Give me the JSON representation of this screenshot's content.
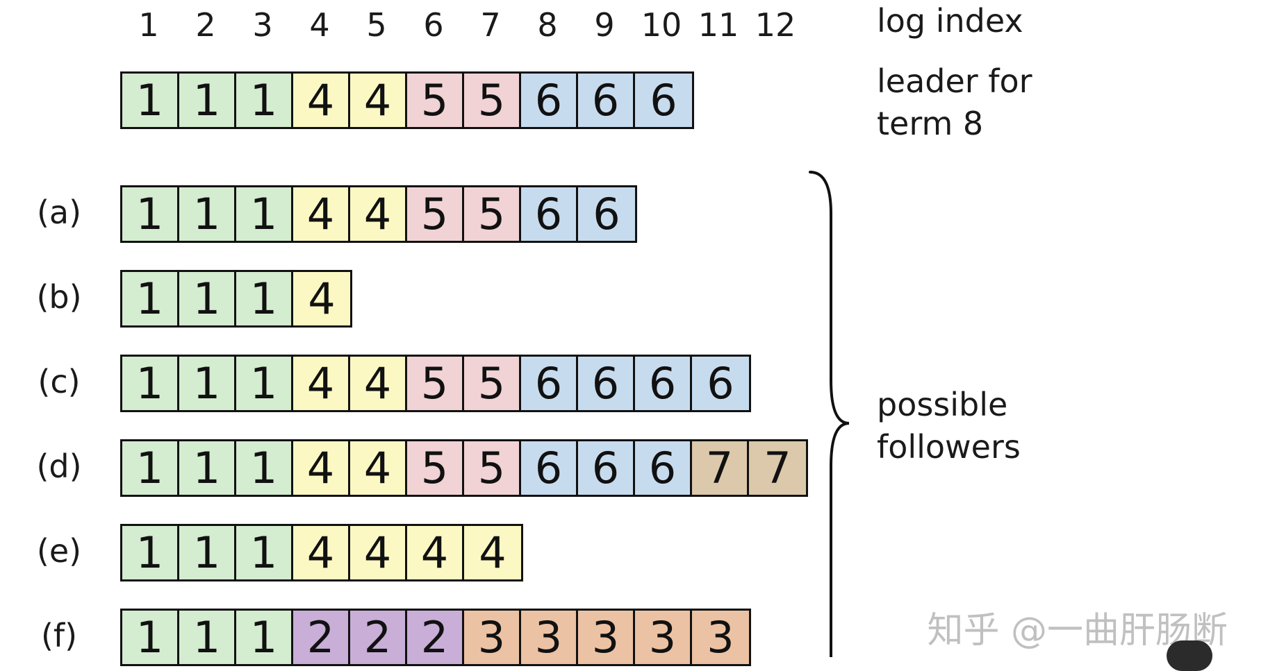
{
  "header": {
    "indices": [
      "1",
      "2",
      "3",
      "4",
      "5",
      "6",
      "7",
      "8",
      "9",
      "10",
      "11",
      "12"
    ],
    "index_caption": "log index"
  },
  "leader": {
    "caption_line1": "leader for",
    "caption_line2": "term 8",
    "entries": [
      1,
      1,
      1,
      4,
      4,
      5,
      5,
      6,
      6,
      6
    ]
  },
  "followers": {
    "caption_line1": "possible",
    "caption_line2": "followers",
    "rows": [
      {
        "label": "(a)",
        "entries": [
          1,
          1,
          1,
          4,
          4,
          5,
          5,
          6,
          6
        ]
      },
      {
        "label": "(b)",
        "entries": [
          1,
          1,
          1,
          4
        ]
      },
      {
        "label": "(c)",
        "entries": [
          1,
          1,
          1,
          4,
          4,
          5,
          5,
          6,
          6,
          6,
          6
        ]
      },
      {
        "label": "(d)",
        "entries": [
          1,
          1,
          1,
          4,
          4,
          5,
          5,
          6,
          6,
          6,
          7,
          7
        ]
      },
      {
        "label": "(e)",
        "entries": [
          1,
          1,
          1,
          4,
          4,
          4,
          4
        ]
      },
      {
        "label": "(f)",
        "entries": [
          1,
          1,
          1,
          2,
          2,
          2,
          3,
          3,
          3,
          3,
          3
        ]
      }
    ]
  },
  "term_colors": {
    "1": "#d4ecd0",
    "2": "#c9aed8",
    "3": "#ecc2a4",
    "4": "#fbf8c4",
    "5": "#f1d3d5",
    "6": "#c7dbee",
    "7": "#dcc8ab"
  },
  "watermark": "知乎 @一曲肝肠断"
}
